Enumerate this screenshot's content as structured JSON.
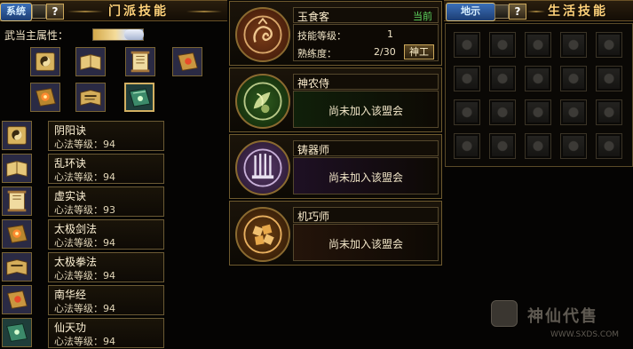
{
  "left_panel": {
    "tab_fragment": "系统",
    "help_label": "?",
    "title": "门派技能",
    "attribute_label": "武当主属性：",
    "icon_grid": [
      {
        "icon": "yinyang-scroll-icon"
      },
      {
        "icon": "open-book-icon"
      },
      {
        "icon": "scroll-icon"
      },
      {
        "icon": "book-icon"
      },
      {
        "icon": "sword-book-icon"
      },
      {
        "icon": "fist-book-icon"
      },
      {
        "icon": "green-book-icon"
      }
    ],
    "skills": [
      {
        "name": "阴阳诀",
        "level": "心法等级：94",
        "icon": "yinyang-scroll-icon"
      },
      {
        "name": "乱环诀",
        "level": "心法等级：94",
        "icon": "open-book-icon"
      },
      {
        "name": "虚实诀",
        "level": "心法等级：93",
        "icon": "scroll-icon"
      },
      {
        "name": "太极剑法",
        "level": "心法等级：94",
        "icon": "sword-book-icon"
      },
      {
        "name": "太极拳法",
        "level": "心法等级：94",
        "icon": "fist-book-icon"
      },
      {
        "name": "南华经",
        "level": "心法等级：94",
        "icon": "book-icon"
      },
      {
        "name": "仙天功",
        "level": "心法等级：94",
        "icon": "green-book-icon"
      }
    ]
  },
  "professions": [
    {
      "name": "玉食客",
      "status": "当前",
      "level_label": "技能等级：",
      "level_value": "1",
      "proficiency_label": "熟练度：",
      "proficiency_value": "2/30",
      "button_label": "神工",
      "emblem": "dragon-emblem-icon",
      "color": "#5a2c14"
    },
    {
      "name": "神农侍",
      "message": "尚未加入该盟会",
      "emblem": "herb-emblem-icon",
      "color": "#1f3f14"
    },
    {
      "name": "铸器师",
      "message": "尚未加入该盟会",
      "emblem": "weapon-rack-emblem-icon",
      "color": "#3a2448"
    },
    {
      "name": "机巧师",
      "message": "尚未加入该盟会",
      "emblem": "gear-emblem-icon",
      "color": "#4a2c0e"
    }
  ],
  "right_panel": {
    "tab_fragment": "地示",
    "help_label": "?",
    "title": "生活技能",
    "empty_slots": 20
  },
  "watermark": {
    "text": "神仙代售",
    "url": "WWW.SXDS.COM"
  }
}
